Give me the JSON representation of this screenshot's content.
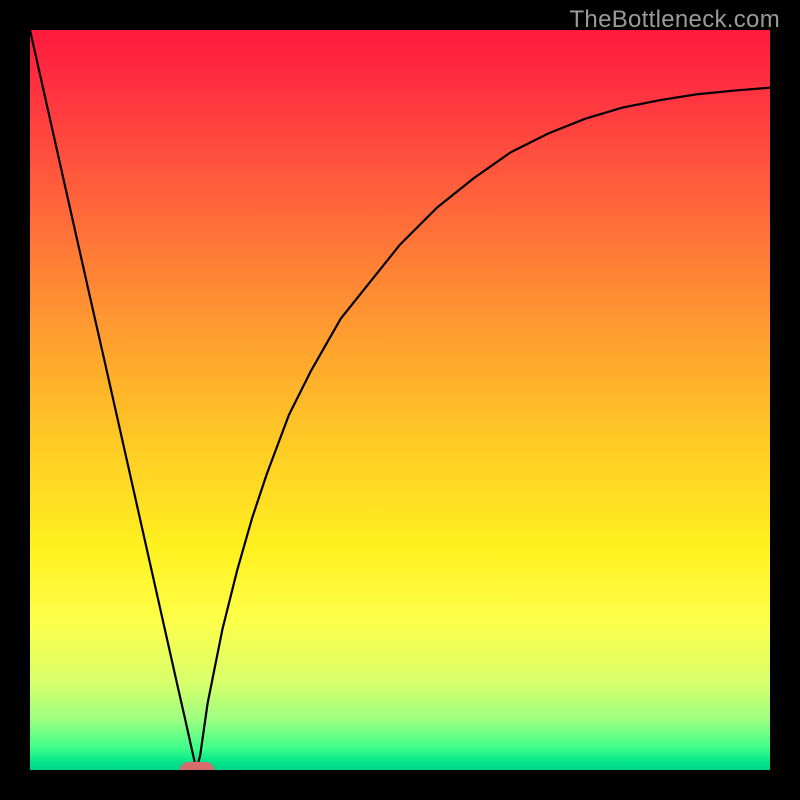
{
  "watermark": "TheBottleneck.com",
  "chart_data": {
    "type": "line",
    "title": "",
    "xlabel": "",
    "ylabel": "",
    "xlim": [
      0,
      100
    ],
    "ylim": [
      0,
      100
    ],
    "curve_x": [
      0,
      2,
      4,
      6,
      8,
      10,
      12,
      14,
      16,
      18,
      20,
      21,
      22,
      22.5,
      23,
      24,
      26,
      28,
      30,
      32,
      35,
      38,
      42,
      46,
      50,
      55,
      60,
      65,
      70,
      75,
      80,
      85,
      90,
      95,
      100
    ],
    "curve_y": [
      100,
      91.1,
      82.2,
      73.3,
      64.4,
      55.6,
      46.7,
      37.8,
      28.9,
      20,
      11.1,
      6.7,
      2.2,
      0,
      2,
      9,
      19,
      27,
      34,
      40,
      48,
      54,
      61,
      66,
      71,
      76,
      80,
      83.5,
      86,
      88,
      89.5,
      90.5,
      91.3,
      91.8,
      92.2
    ],
    "marker": {
      "x": 22.5,
      "y": 0,
      "shape": "oval",
      "color": "#d66d6d"
    },
    "gradient_colors": [
      "#ff1a3c",
      "#ff6a3a",
      "#ffc825",
      "#fff11f",
      "#9fff80",
      "#00d488"
    ]
  }
}
